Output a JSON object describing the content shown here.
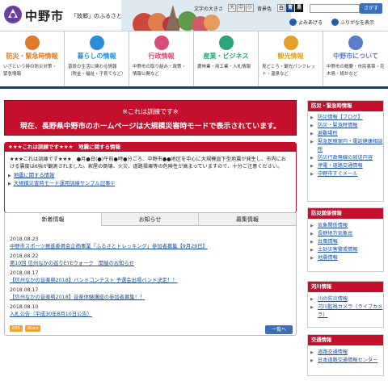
{
  "header": {
    "site_name": "中野市",
    "tagline": "「故郷」のふるさと",
    "font_size_label": "文字の大きさ",
    "font_sizes": [
      "大",
      "中",
      "小"
    ],
    "bg_color_label": "背景色",
    "bg_colors": [
      "白",
      "青",
      "黒"
    ],
    "search_placeholder": "",
    "search_button": "さがす",
    "reading_aloud": "よみあげる",
    "furigana": "ふりがなを表示"
  },
  "nav": [
    {
      "title": "防災・緊急時情報",
      "sub": "いざという時の防災対策・緊急情報",
      "icon": "disaster-icon",
      "color": "#e07a2b"
    },
    {
      "title": "暮らしの情報",
      "sub": "普段の生活に関わる情報（税金・福祉・子育てなど）",
      "icon": "home-icon",
      "color": "#2b8fd8"
    },
    {
      "title": "行政情報",
      "sub": "中野市の取り組み・政策・情報公開など",
      "icon": "government-icon",
      "color": "#d84b7a"
    },
    {
      "title": "産業・ビジネス",
      "sub": "農林業・商工業・入札情報",
      "icon": "industry-icon",
      "color": "#2ba67a"
    },
    {
      "title": "観光情報",
      "sub": "見どころ・観光パンフレット・温泉など",
      "icon": "tourism-icon",
      "color": "#e0a22b"
    },
    {
      "title": "中野市について",
      "sub": "中野市の概要・市民憲章・花木鳥・統計など",
      "icon": "city-icon",
      "color": "#5a7fc8"
    }
  ],
  "alert": {
    "line1": "※これは訓練です※",
    "line2": "現在、長野県中野市のホームページは大規模災害時モードで表示されています。"
  },
  "disaster_info": {
    "heading": "★★★これは訓練です★★★　地震に関する情報",
    "body": "★★★これは訓練です★★★　●月●日(●)午前●時●分ごろ、中野市●●地区を中心に大規模直下型地震が発生し、市内における震度は6強が観測されました。家屋の倒壊、火災、道路損壊等の危険性が高まっていますので、十分ご注意ください。",
    "links": [
      "地震に関する情報",
      "大規模災害時モード運用訓練サンプル記事①"
    ]
  },
  "news": {
    "tabs": [
      "新着情報",
      "お知らせ",
      "募集情報"
    ],
    "items": [
      {
        "date": "2018.08.23",
        "title": "中野市スポーツ推進委員会企画事業「ふるさとトレッキング」参加者募集【9月29日】"
      },
      {
        "date": "2018.08.22",
        "title": "第10回 信州なかの巡りEYEウォーク　開催のお知らせ"
      },
      {
        "date": "2018.08.17",
        "title": "【信州なかの音楽祭2018】バンドコンテスト 予選会出場バンド決定！！"
      },
      {
        "date": "2018.08.17",
        "title": "【信州なかの音楽祭2018】音楽体験講座の参加者募集！！"
      },
      {
        "date": "2018.08.10",
        "title": "入札公告（平成30年8月10日公告）"
      }
    ],
    "badges": [
      "RSS",
      "Atom"
    ],
    "list_button": "一覧へ"
  },
  "sidebar": [
    {
      "heading": "防災・緊急時情報",
      "items": [
        "防災情報【ブログ】",
        "防災・緊急時情報",
        "避難場所",
        "緊急医療案内・電話健康相談所",
        "防災行政無線の放送内容",
        "停電・道路交通情報",
        "中野市すぐメール"
      ]
    },
    {
      "heading": "防災関係情報",
      "items": [
        "気象関係情報",
        "長野地方気象台",
        "台風情報",
        "土砂災害警戒情報",
        "地震情報"
      ]
    },
    {
      "heading": "河川情報",
      "items": [
        "川の防災情報",
        "河川監視カメラ（ライブカメラ）"
      ]
    },
    {
      "heading": "交通情報",
      "items": [
        "道路交通情報",
        "日本道路交通情報センター"
      ]
    }
  ]
}
